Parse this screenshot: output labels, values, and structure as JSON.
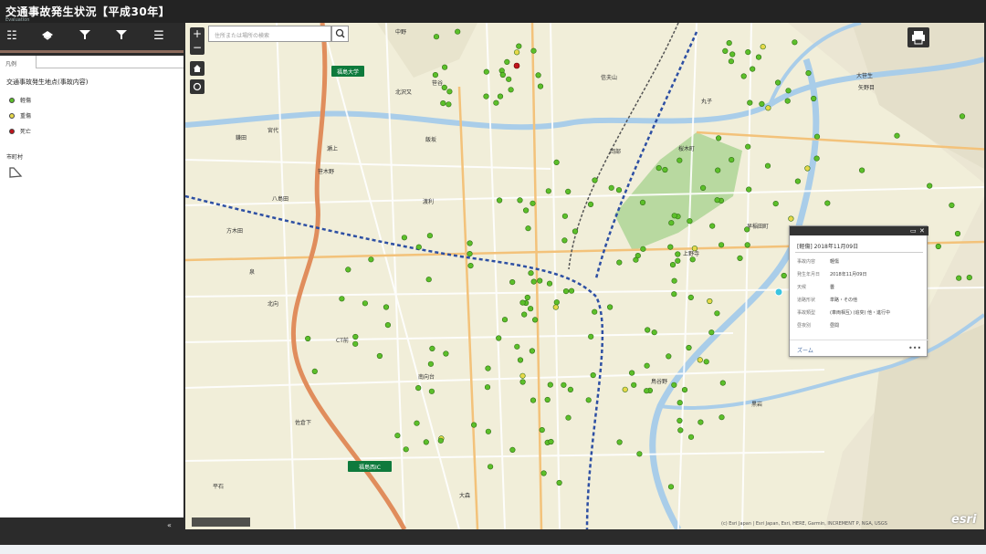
{
  "app": {
    "title": "交通事故発生状況【平成30年】",
    "subtitle": "Evaluation"
  },
  "toolbar": {
    "items": [
      {
        "name": "legend-list-icon",
        "glyph": "☷"
      },
      {
        "name": "layers-icon",
        "glyph": "◈"
      },
      {
        "name": "filter-icon",
        "glyph": "▼"
      },
      {
        "name": "filter-icon",
        "glyph": "▼"
      },
      {
        "name": "menu-icon",
        "glyph": "☰"
      }
    ],
    "accent_color": "#8c6a5c"
  },
  "panel": {
    "tab_label": "凡例",
    "layer_title": "交通事故発生地点(事故内容)",
    "legend": [
      {
        "label": "軽傷",
        "color": "#5cbf2a"
      },
      {
        "label": "重傷",
        "color": "#e6d84a"
      },
      {
        "label": "死亡",
        "color": "#c0141c"
      }
    ],
    "boundary_title": "市町村"
  },
  "map": {
    "search_placeholder": "住所または場所の検索",
    "attribution": "(c) Esri Japan | Esri Japan, Esri, HERE, Garmin, INCREMENT P, NGA, USGS",
    "logo": "esri",
    "station_labels": [
      "福島大学",
      "福島西IC"
    ],
    "place_labels": [
      "中野",
      "笹谷",
      "北沢又",
      "飯坂",
      "丸子",
      "桜木町",
      "鎌田",
      "瀬上",
      "岡部",
      "矢野目",
      "早稲田町",
      "笹木野",
      "八島田",
      "渡利",
      "上野寺",
      "泉",
      "北向",
      "CT前",
      "南向台",
      "佐倉下",
      "鳥谷野",
      "黒岩",
      "大森",
      "平石",
      "宮代",
      "信夫山",
      "大笹生",
      "方木田"
    ]
  },
  "popup": {
    "title": "[軽傷] 2018年11月09日",
    "rows": [
      {
        "label": "事故内容",
        "value": "軽傷"
      },
      {
        "label": "発生年月日",
        "value": "2018年11月09日"
      },
      {
        "label": "天候",
        "value": "曇"
      },
      {
        "label": "道路形状",
        "value": "単路・その他"
      },
      {
        "label": "事故類型",
        "value": "(車両相互) (追突) 他・進行中"
      },
      {
        "label": "昼夜別",
        "value": "昼間"
      }
    ],
    "zoom_label": "ズーム",
    "more_label": "•••"
  },
  "footer": {
    "collapse_label": "«"
  }
}
